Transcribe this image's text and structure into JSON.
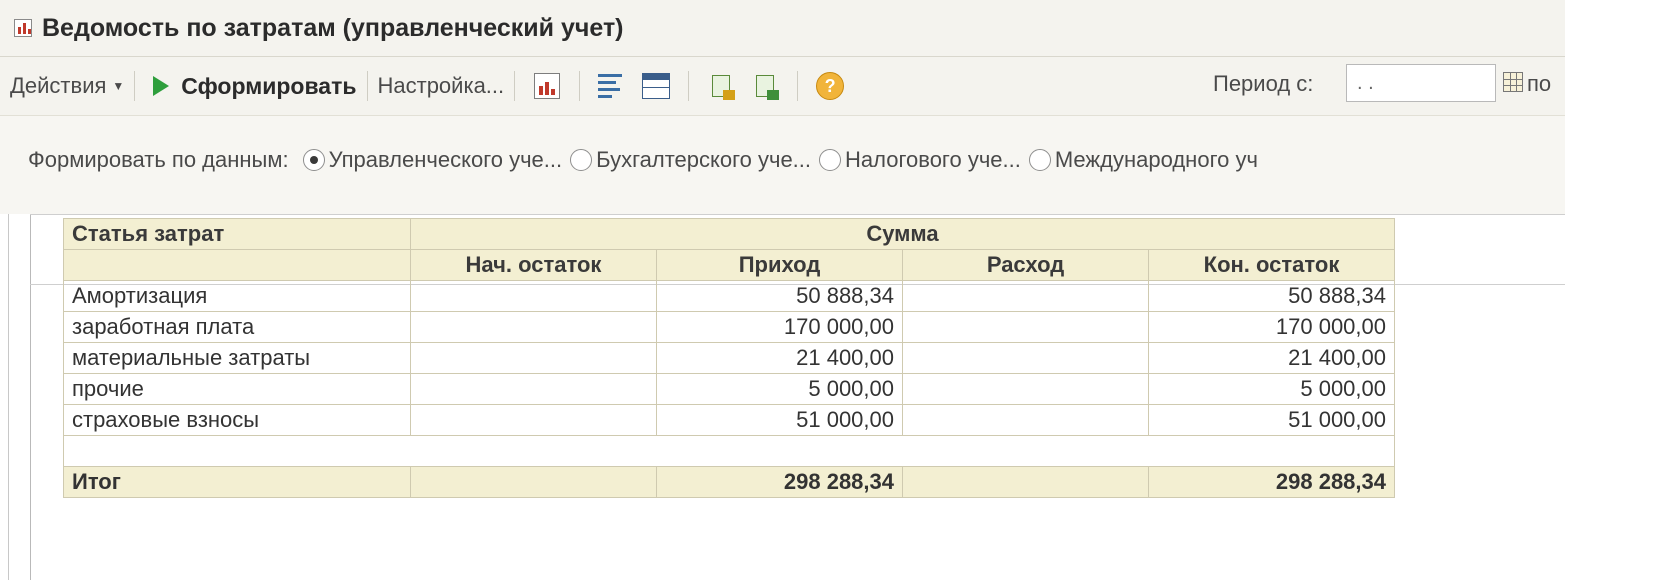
{
  "window": {
    "title": "Ведомость по затратам (управленческий учет)"
  },
  "toolbar": {
    "actions_label": "Действия",
    "generate_label": "Сформировать",
    "settings_label": "Настройка...",
    "icons": [
      "report-icon",
      "filter-icon",
      "table-icon",
      "save-icon",
      "load-icon",
      "help-icon"
    ],
    "help_glyph": "?",
    "period_label": "Период с:",
    "period_value": ". .",
    "period_po": "по"
  },
  "settings": {
    "form_by_label": "Формировать по данным:",
    "options": [
      {
        "label": "Управленческого уче...",
        "selected": true
      },
      {
        "label": "Бухгалтерского уче...",
        "selected": false
      },
      {
        "label": "Налогового уче...",
        "selected": false
      },
      {
        "label": "Международного уч",
        "selected": false
      }
    ]
  },
  "report": {
    "header": {
      "item_col": "Статья затрат",
      "sum_group": "Сумма",
      "columns": [
        "Нач. остаток",
        "Приход",
        "Расход",
        "Кон. остаток"
      ]
    },
    "rows": [
      {
        "item": "Амортизация",
        "start": "",
        "income": "50 888,34",
        "expense": "",
        "end": "50 888,34"
      },
      {
        "item": "заработная плата",
        "start": "",
        "income": "170 000,00",
        "expense": "",
        "end": "170 000,00"
      },
      {
        "item": "материальные затраты",
        "start": "",
        "income": "21 400,00",
        "expense": "",
        "end": "21 400,00"
      },
      {
        "item": "прочие",
        "start": "",
        "income": "5 000,00",
        "expense": "",
        "end": "5 000,00"
      },
      {
        "item": "страховые взносы",
        "start": "",
        "income": "51 000,00",
        "expense": "",
        "end": "51 000,00"
      }
    ],
    "total": {
      "label": "Итог",
      "start": "",
      "income": "298 288,34",
      "expense": "",
      "end": "298 288,34"
    }
  },
  "colors": {
    "panel_bg": "#f4f3ee",
    "header_bg": "#f3efd2",
    "grid_border": "#cfcab0",
    "play_green": "#2e9e3c",
    "help_orange": "#f1b43a"
  }
}
